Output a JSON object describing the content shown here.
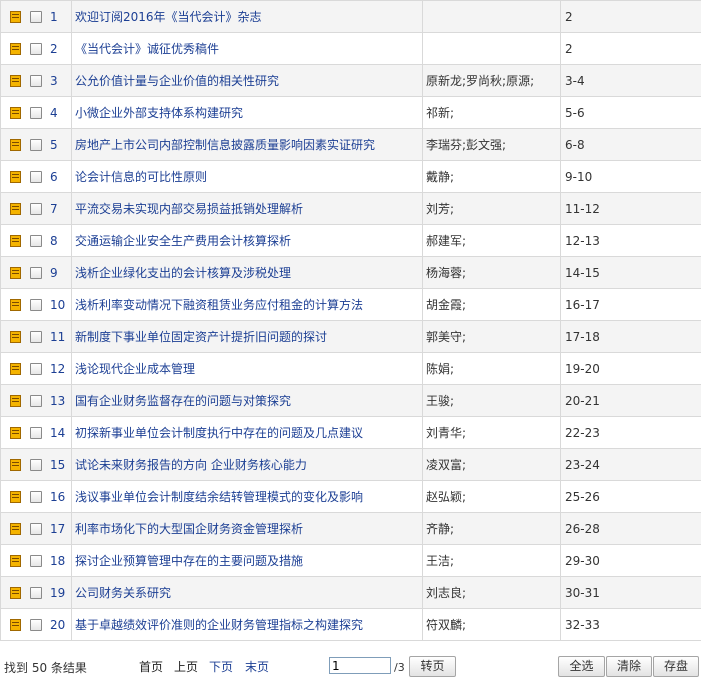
{
  "results": [
    {
      "num": "1",
      "title": "欢迎订阅2016年《当代会计》杂志",
      "author": "",
      "pages": "2"
    },
    {
      "num": "2",
      "title": "《当代会计》诚征优秀稿件",
      "author": "",
      "pages": "2"
    },
    {
      "num": "3",
      "title": "公允价值计量与企业价值的相关性研究",
      "author": "原新龙;罗尚秋;原源;",
      "pages": "3-4"
    },
    {
      "num": "4",
      "title": "小微企业外部支持体系构建研究",
      "author": "祁新;",
      "pages": "5-6"
    },
    {
      "num": "5",
      "title": "房地产上市公司内部控制信息披露质量影响因素实证研究",
      "author": "李瑞芬;彭文强;",
      "pages": "6-8"
    },
    {
      "num": "6",
      "title": "论会计信息的可比性原则",
      "author": "戴静;",
      "pages": "9-10"
    },
    {
      "num": "7",
      "title": "平流交易未实现内部交易损益抵销处理解析",
      "author": "刘芳;",
      "pages": "11-12"
    },
    {
      "num": "8",
      "title": "交通运输企业安全生产费用会计核算探析",
      "author": "郝建军;",
      "pages": "12-13"
    },
    {
      "num": "9",
      "title": "浅析企业绿化支出的会计核算及涉税处理",
      "author": "杨海蓉;",
      "pages": "14-15"
    },
    {
      "num": "10",
      "title": "浅析利率变动情况下融资租赁业务应付租金的计算方法",
      "author": "胡金霞;",
      "pages": "16-17"
    },
    {
      "num": "11",
      "title": "新制度下事业单位固定资产计提折旧问题的探讨",
      "author": "郭美守;",
      "pages": "17-18"
    },
    {
      "num": "12",
      "title": "浅论现代企业成本管理",
      "author": "陈娟;",
      "pages": "19-20"
    },
    {
      "num": "13",
      "title": "国有企业财务监督存在的问题与对策探究",
      "author": "王骏;",
      "pages": "20-21"
    },
    {
      "num": "14",
      "title": "初探新事业单位会计制度执行中存在的问题及几点建议",
      "author": "刘青华;",
      "pages": "22-23"
    },
    {
      "num": "15",
      "title": "试论未来财务报告的方向 企业财务核心能力",
      "author": "凌双富;",
      "pages": "23-24"
    },
    {
      "num": "16",
      "title": "浅议事业单位会计制度结余结转管理模式的变化及影响",
      "author": "赵弘颖;",
      "pages": "25-26"
    },
    {
      "num": "17",
      "title": "利率市场化下的大型国企财务资金管理探析",
      "author": "齐静;",
      "pages": "26-28"
    },
    {
      "num": "18",
      "title": "探讨企业预算管理中存在的主要问题及措施",
      "author": "王洁;",
      "pages": "29-30"
    },
    {
      "num": "19",
      "title": "公司财务关系研究",
      "author": "刘志良;",
      "pages": "30-31"
    },
    {
      "num": "20",
      "title": "基于卓越绩效评价准则的企业财务管理指标之构建探究",
      "author": "符双麟;",
      "pages": "32-33"
    }
  ],
  "footer": {
    "result_count": "找到 50 条结果",
    "first_page": "首页",
    "prev_page": "上页",
    "next_page": "下页",
    "last_page": "末页",
    "page_input_value": "1",
    "total_pages": "/3",
    "go_button": "转页",
    "select_all_button": "全选",
    "clear_button": "清除",
    "save_button": "存盘"
  },
  "colors": {
    "link": "#1c3f94",
    "row_stripe": "#f4f4f4",
    "grid_line": "#d9d9d9",
    "doc_icon": "#f5b400"
  },
  "icons": {
    "row_icon": "document-icon",
    "row_checkbox": "checkbox"
  }
}
